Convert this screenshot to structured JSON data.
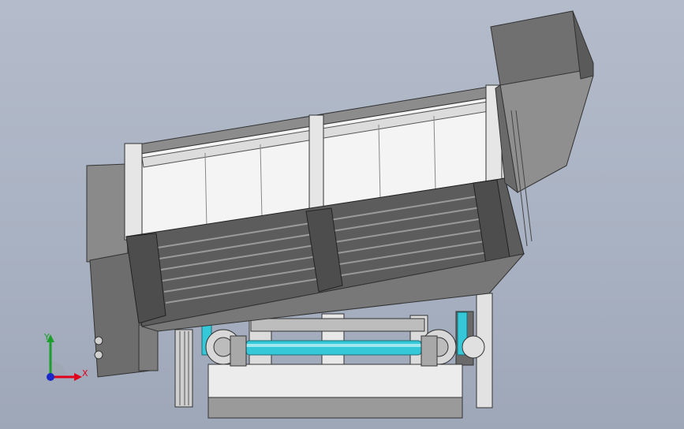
{
  "viewport": {
    "background_top": "#b4bccb",
    "background_bottom": "#9ea7b8",
    "model_shading": "#6e6e6e"
  },
  "triad": {
    "x_label": "X",
    "y_label": "Y",
    "x_color": "#e0001c",
    "y_color": "#1c9e2c",
    "z_color": "#1a28c8"
  },
  "parts": {
    "cyan_pipe_color": "#35c8d8",
    "panel_color": "#f4f4f4",
    "frame_color": "#5c5c5c"
  }
}
